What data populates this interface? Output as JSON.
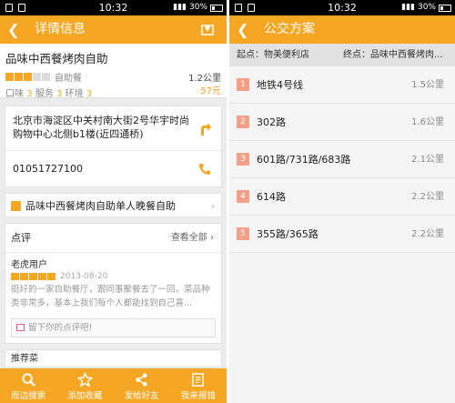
{
  "status_left": {
    "time": "10:32",
    "battery": "30%"
  },
  "status_right": {
    "time": "10:32",
    "battery": "30%"
  },
  "detail": {
    "title": "详情信息",
    "back_glyph": "❮",
    "shop": {
      "name": "品味中西餐烤肉自助",
      "category": "自助餐",
      "rating_stars": 3,
      "distance": "1.2公里",
      "taste_label": "口味",
      "taste": "3",
      "service_label": "服务",
      "service": "3",
      "env_label": "环境",
      "env": "3",
      "price": "57元"
    },
    "address": "北京市海淀区中关村南大街2号华宇时尚购物中心北侧b1楼(近四通桥)",
    "phone": "01051727100",
    "deal": "品味中西餐烤肉自助单人晚餐自助",
    "reviews": {
      "heading": "点评",
      "see_all": "查看全部",
      "user": "老虎用户",
      "rating_stars": 5,
      "date": "2013-08-20",
      "text": "挺好的一家自助餐厅，跟同事聚餐去了一回，菜品种类非常多，基本上我们每个人都能找到自己喜...",
      "comment_placeholder": "留下你的点评吧!"
    },
    "recommend_label": "推荐菜",
    "tabs": [
      {
        "label": "周边搜索",
        "icon": "search-icon"
      },
      {
        "label": "添加收藏",
        "icon": "star-icon"
      },
      {
        "label": "发给好友",
        "icon": "share-icon"
      },
      {
        "label": "我来报错",
        "icon": "report-icon"
      }
    ],
    "colors": {
      "accent": "#f5a623",
      "number_badge": "#f4a088"
    }
  },
  "transit": {
    "title": "公交方案",
    "back_glyph": "❮",
    "start": "起点：物美便利店",
    "end": "终点：品味中西餐烤肉...",
    "plans": [
      {
        "num": "1",
        "name": "地铁4号线",
        "distance": "1.5公里"
      },
      {
        "num": "2",
        "name": "302路",
        "distance": "1.6公里"
      },
      {
        "num": "3",
        "name": "601路/731路/683路",
        "distance": "2.1公里"
      },
      {
        "num": "4",
        "name": "614路",
        "distance": "2.2公里"
      },
      {
        "num": "5",
        "name": "355路/365路",
        "distance": "2.2公里"
      }
    ]
  }
}
